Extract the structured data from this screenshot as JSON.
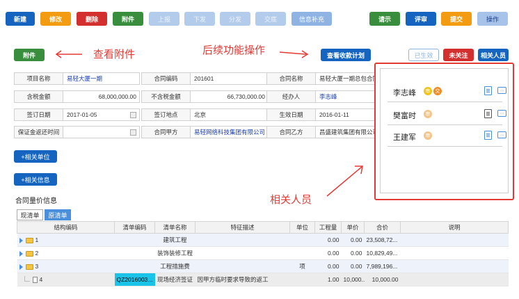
{
  "toolbar": {
    "new": "新建",
    "edit": "修改",
    "delete": "删除",
    "attach": "附件",
    "report": "上报",
    "issue": "下发",
    "distribute": "分发",
    "submit_deal": "交底",
    "info_supplement": "信息补充",
    "request": "请示",
    "review": "评审",
    "submit": "提交",
    "operate": "操作"
  },
  "annotations": {
    "view_attachments": "查看附件",
    "follow_up": "后续功能操作",
    "related_persons": "相关人员"
  },
  "actions": {
    "attach": "附件",
    "view_payment_plan": "查看收款计划",
    "status_effective": "已生效",
    "unfollowed": "未关注",
    "related_persons": "相关人员"
  },
  "form": {
    "project_name_label": "项目名称",
    "project_name": "易轻大厦一期",
    "contract_no_label": "合同编码",
    "contract_no": "201601",
    "contract_name_label": "合同名称",
    "contract_name": "易轻大厦一期总包合同",
    "tax_incl_label": "含税金额",
    "tax_incl": "68,000,000.00",
    "tax_excl_label": "不含税金额",
    "tax_excl": "66,730,000.00",
    "handler_label": "经办人",
    "handler": "李志峰",
    "sign_date_label": "签订日期",
    "sign_date": "2017-01-05",
    "sign_place_label": "签订地点",
    "sign_place": "北京",
    "effect_date_label": "生效日期",
    "effect_date": "2016-01-11",
    "deposit_return_label": "保证金返还时间",
    "deposit_return": "",
    "party_a_label": "合同甲方",
    "party_a": "易轻网络科技集团有限公司",
    "party_b_label": "合同乙方",
    "party_b": "昌盛建筑集团有限公司"
  },
  "buttons": {
    "add_related_unit": "+相关单位",
    "add_related_info": "+相关信息"
  },
  "persons": [
    {
      "name": "李志峰",
      "badge1": "审",
      "badge2": "交"
    },
    {
      "name": "樊富时",
      "badge1": "审"
    },
    {
      "name": "王建军",
      "badge1": "审"
    }
  ],
  "pricing": {
    "title": "合同量价信息",
    "tab_current": "现清单",
    "tab_original": "原清单",
    "headers": [
      "结构编码",
      "清单编码",
      "清单名称",
      "特征描述",
      "单位",
      "工程量",
      "单价",
      "合价",
      "说明"
    ],
    "rows": [
      {
        "code": "1",
        "item_code": "",
        "name": "建筑工程",
        "desc": "",
        "unit": "",
        "qty": "0.00",
        "price": "0.00",
        "total": "23,508,72...",
        "note": ""
      },
      {
        "code": "2",
        "item_code": "",
        "name": "装饰装修工程",
        "desc": "",
        "unit": "",
        "qty": "0.00",
        "price": "0.00",
        "total": "10,829,49...",
        "note": ""
      },
      {
        "code": "3",
        "item_code": "",
        "name": "工程措施费",
        "desc": "",
        "unit": "项",
        "qty": "0.00",
        "price": "0.00",
        "total": "7,989,196...",
        "note": ""
      },
      {
        "code": "4",
        "item_code": "QZ2016003...",
        "name": "现场经济签证",
        "desc": "因甲方临时要求导致的返工",
        "unit": "",
        "qty": "1.00",
        "price": "10,000...",
        "total": "10,000.00",
        "note": ""
      }
    ]
  },
  "colors": {
    "primary": "#1565c0",
    "orange": "#f39c12",
    "red": "#d32f2f",
    "green": "#388e3c",
    "annotation": "#e53935"
  }
}
